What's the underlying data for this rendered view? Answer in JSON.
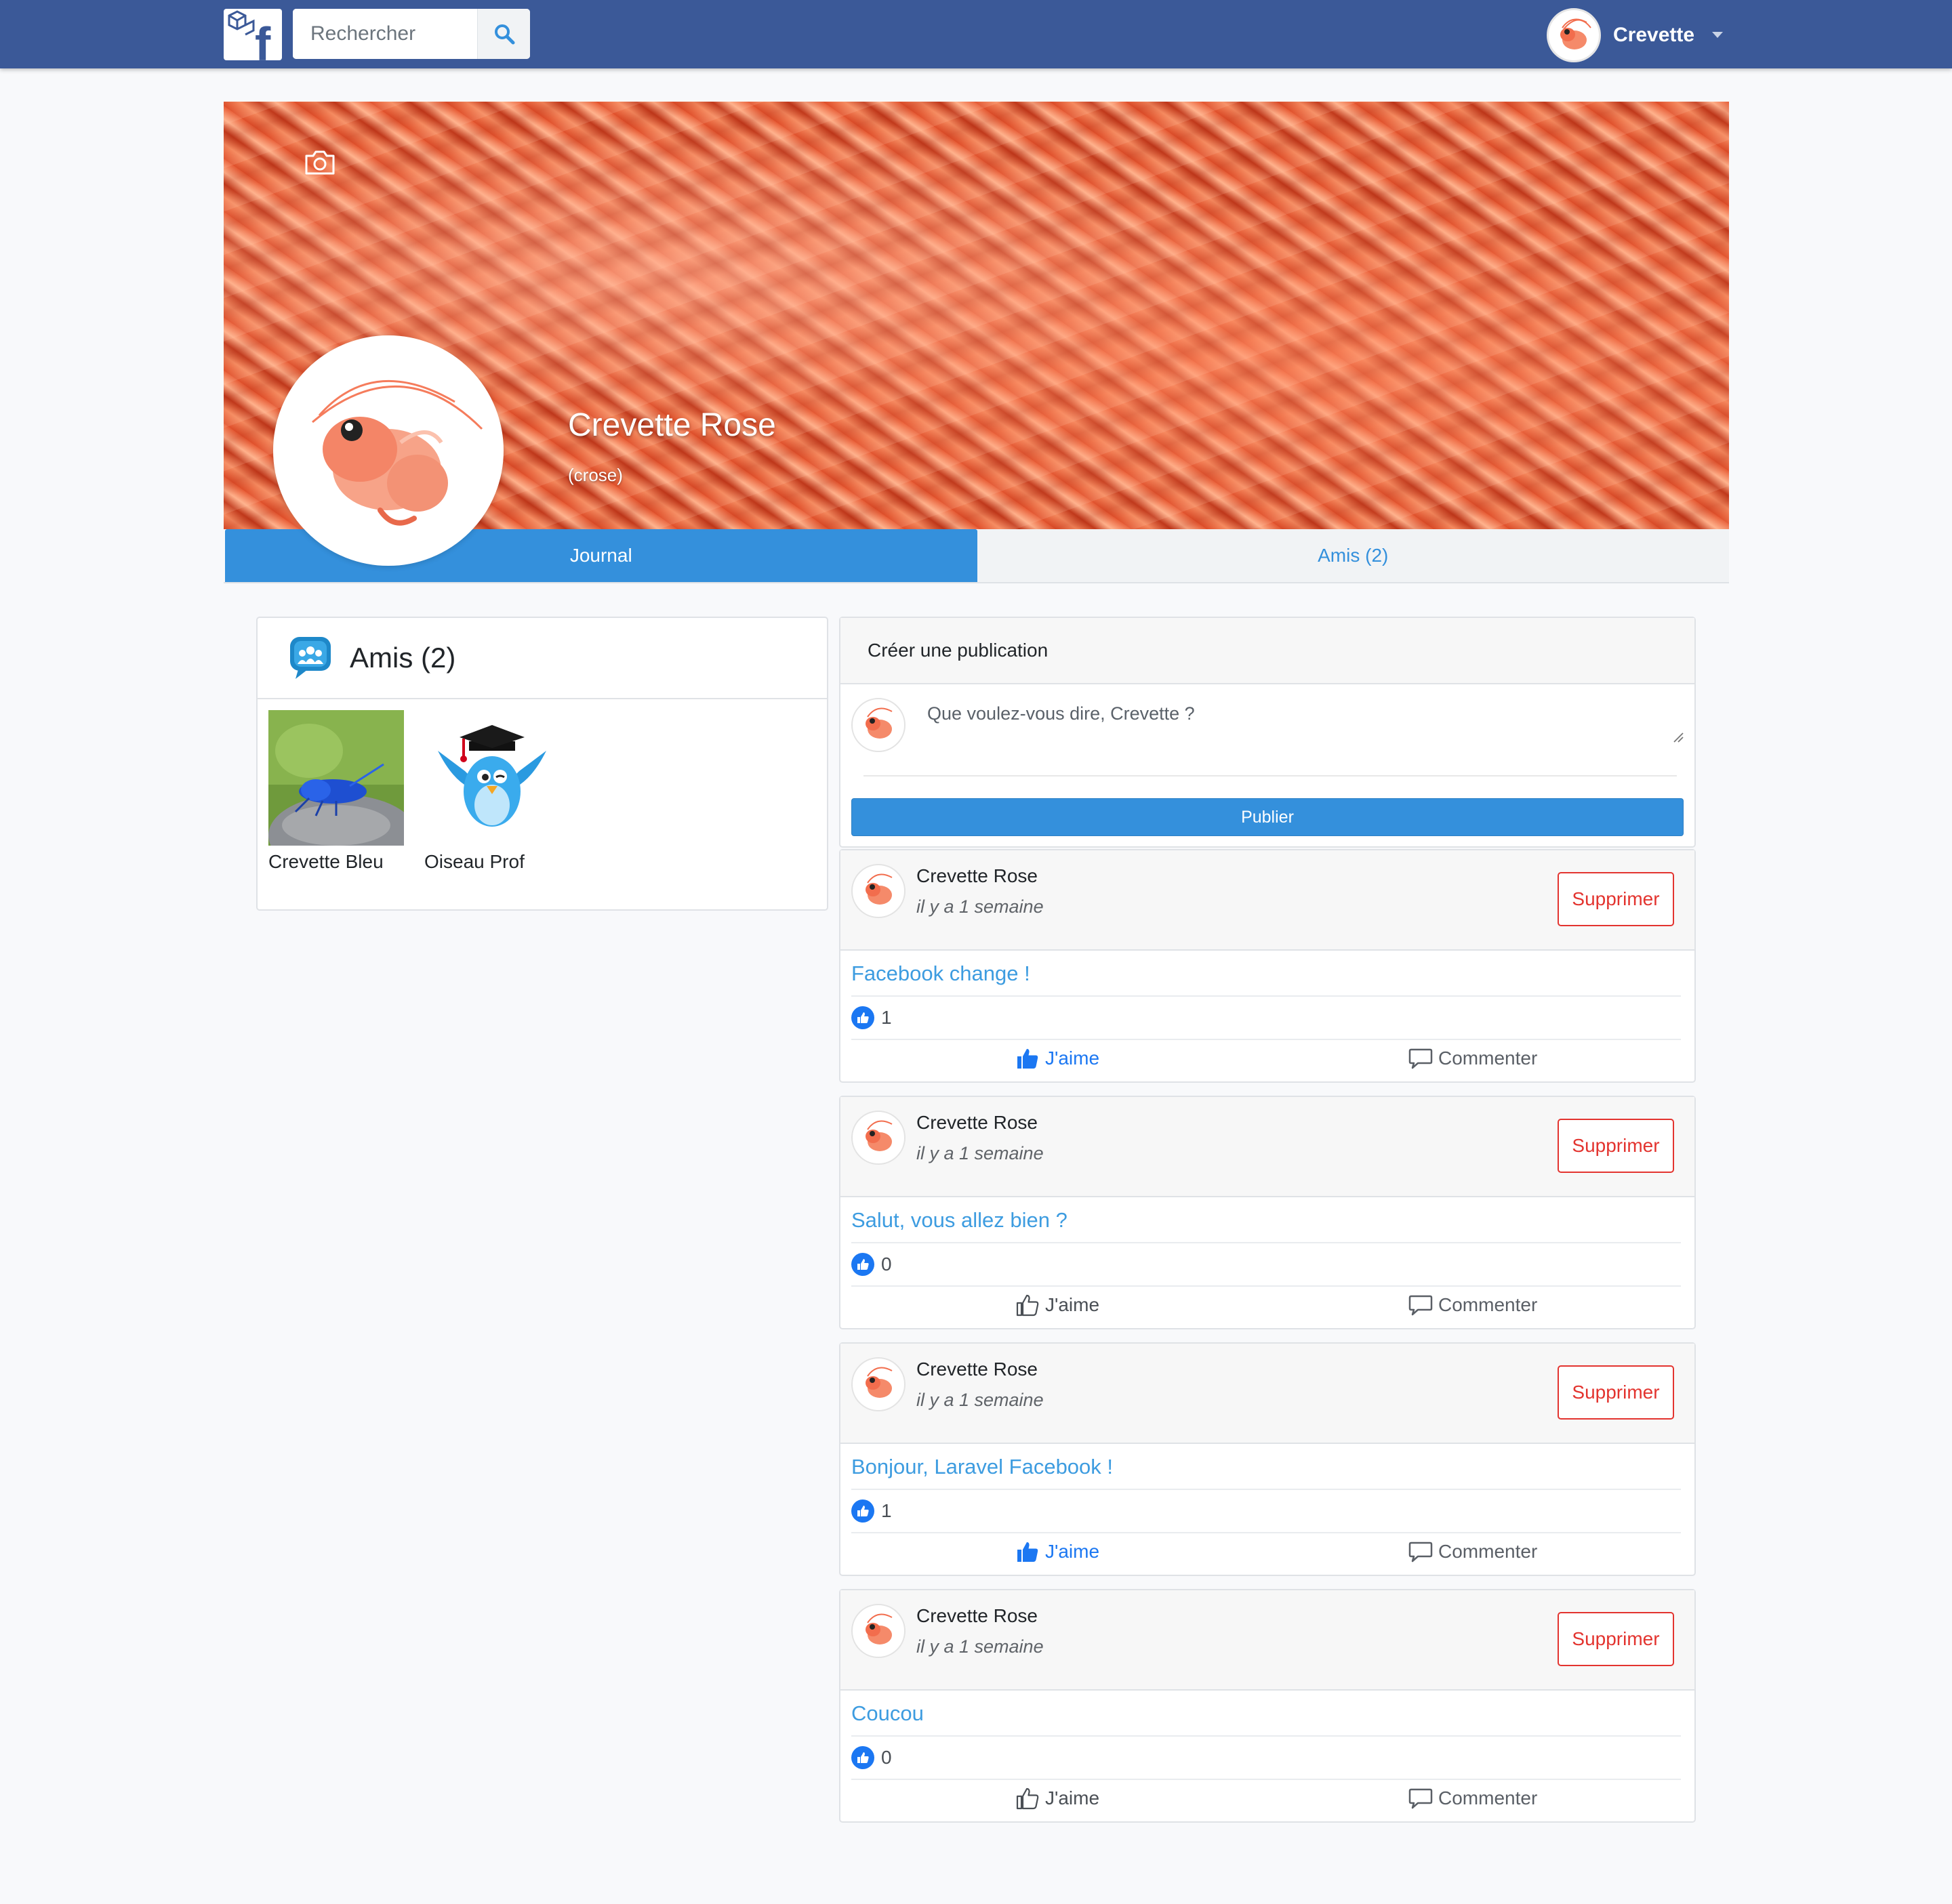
{
  "header": {
    "search_placeholder": "Rechercher",
    "user_name": "Crevette"
  },
  "profile": {
    "name": "Crevette Rose",
    "handle": "(crose)"
  },
  "tabs": [
    {
      "label": "Journal",
      "active": true
    },
    {
      "label": "Amis (2)",
      "active": false
    }
  ],
  "friends": {
    "title": "Amis (2)",
    "items": [
      {
        "name": "Crevette Bleu"
      },
      {
        "name": "Oiseau Prof"
      }
    ]
  },
  "create_post": {
    "title": "Créer une publication",
    "placeholder": "Que voulez-vous dire, Crevette ?",
    "publish_label": "Publier"
  },
  "posts": [
    {
      "author": "Crevette Rose",
      "time": "il y a 1 semaine",
      "text": "Facebook change !",
      "likes": "1",
      "liked": true,
      "delete_label": "Supprimer",
      "like_label": "J'aime",
      "comment_label": "Commenter"
    },
    {
      "author": "Crevette Rose",
      "time": "il y a 1 semaine",
      "text": "Salut, vous allez bien ?",
      "likes": "0",
      "liked": false,
      "delete_label": "Supprimer",
      "like_label": "J'aime",
      "comment_label": "Commenter"
    },
    {
      "author": "Crevette Rose",
      "time": "il y a 1 semaine",
      "text": "Bonjour, Laravel Facebook !",
      "likes": "1",
      "liked": true,
      "delete_label": "Supprimer",
      "like_label": "J'aime",
      "comment_label": "Commenter"
    },
    {
      "author": "Crevette Rose",
      "time": "il y a 1 semaine",
      "text": "Coucou",
      "likes": "0",
      "liked": false,
      "delete_label": "Supprimer",
      "like_label": "J'aime",
      "comment_label": "Commenter"
    }
  ],
  "colors": {
    "navbar": "#3b5998",
    "primary": "#3490dc",
    "danger": "#e3342f",
    "like_blue": "#1b77f2"
  }
}
